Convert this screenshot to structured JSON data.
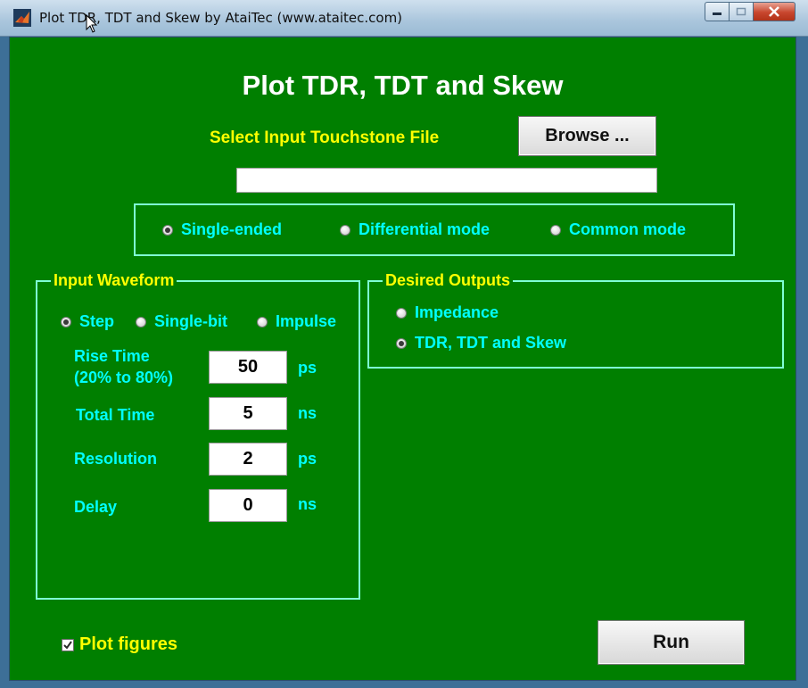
{
  "window": {
    "title": "Plot TDR, TDT and Skew by AtaiTec (www.ataitec.com)"
  },
  "main": {
    "title": "Plot TDR, TDT and Skew",
    "select_label": "Select Input Touchstone File",
    "browse_label": "Browse ...",
    "file_path": ""
  },
  "mode": {
    "options": [
      {
        "label": "Single-ended",
        "selected": true
      },
      {
        "label": "Differential mode",
        "selected": false
      },
      {
        "label": "Common mode",
        "selected": false
      }
    ]
  },
  "input_waveform": {
    "title": "Input Waveform",
    "options": [
      {
        "label": "Step",
        "selected": true
      },
      {
        "label": "Single-bit",
        "selected": false
      },
      {
        "label": "Impulse",
        "selected": false
      }
    ],
    "fields": [
      {
        "label_line1": "Rise Time",
        "label_line2": "(20% to 80%)",
        "value": "50",
        "unit": "ps"
      },
      {
        "label_line1": "Total Time",
        "value": "5",
        "unit": "ns"
      },
      {
        "label_line1": "Resolution",
        "value": "2",
        "unit": "ps"
      },
      {
        "label_line1": "Delay",
        "value": "0",
        "unit": "ns"
      }
    ]
  },
  "desired_outputs": {
    "title": "Desired Outputs",
    "options": [
      {
        "label": "Impedance",
        "selected": false
      },
      {
        "label": "TDR, TDT and Skew",
        "selected": true
      }
    ]
  },
  "footer": {
    "plot_figures_label": "Plot figures",
    "plot_figures_checked": true,
    "run_label": "Run"
  }
}
